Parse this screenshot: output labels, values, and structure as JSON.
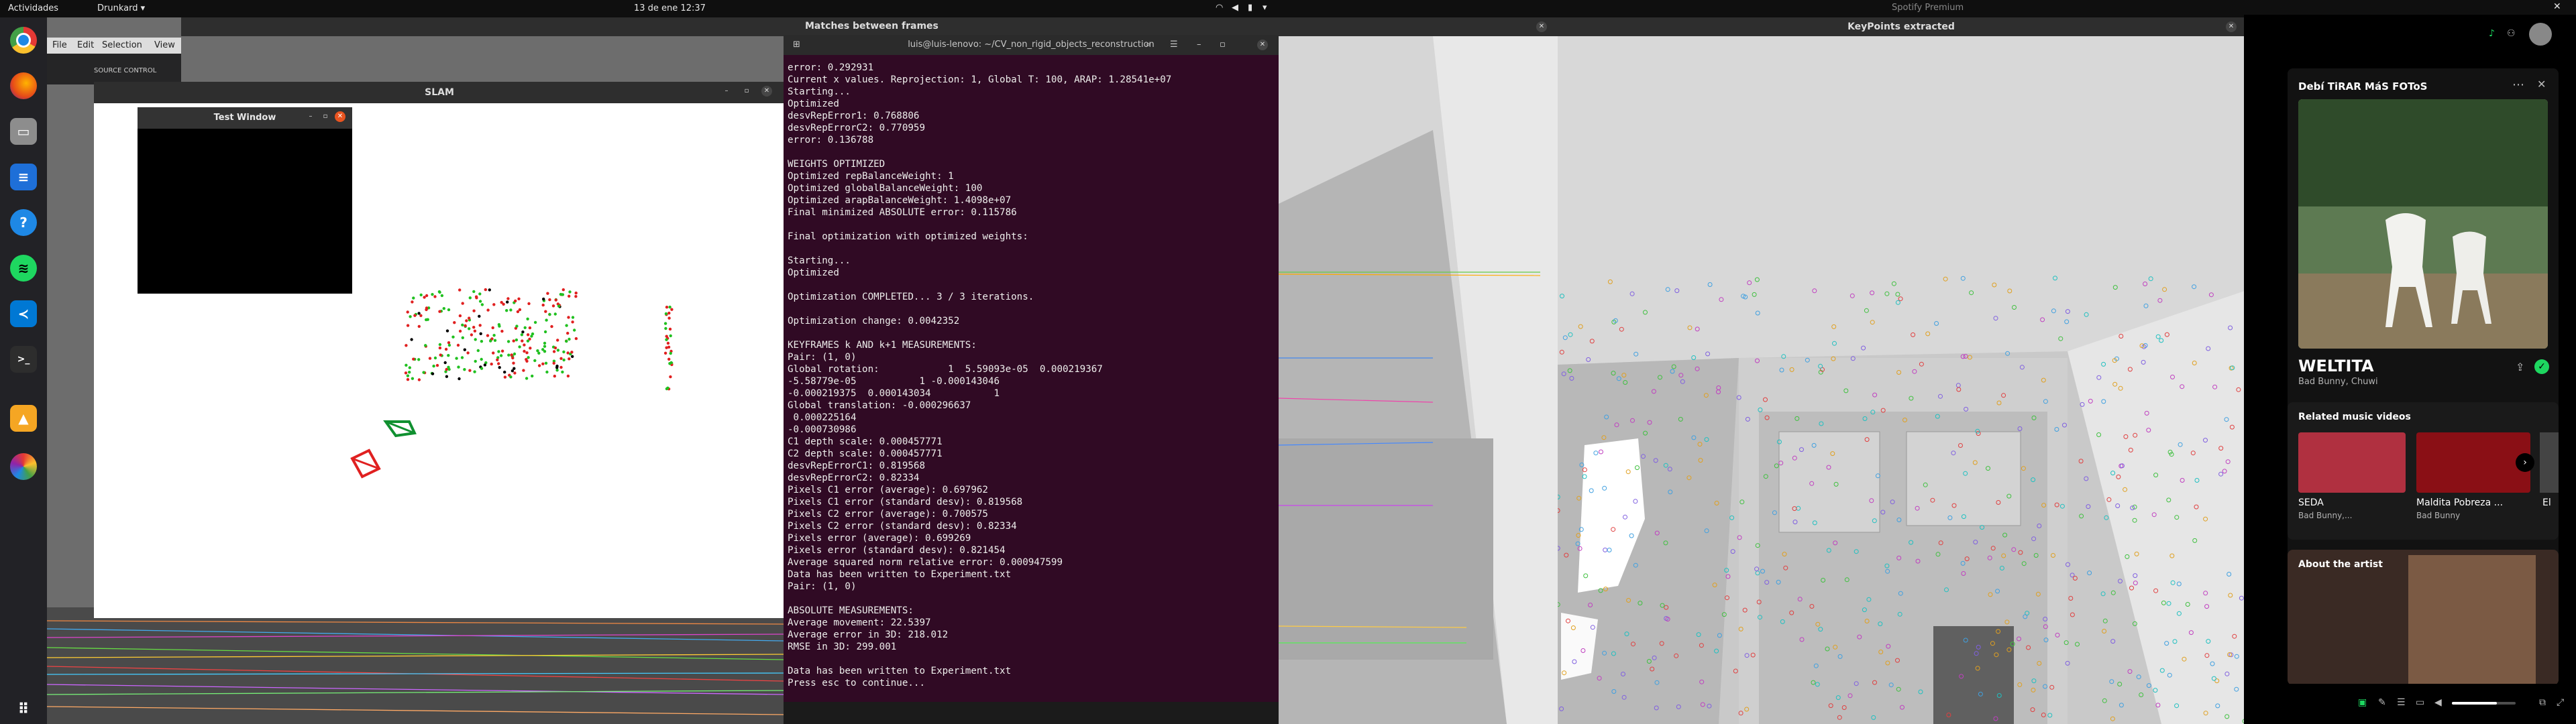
{
  "topbar": {
    "activities": "Actividades",
    "app_menu": "Drunkard",
    "clock": "13 de ene  12:37"
  },
  "dock": {
    "icons": [
      "chrome-icon",
      "firefox-icon",
      "files-icon",
      "writer-icon",
      "help-icon",
      "spotify-icon",
      "vscode-icon",
      "terminal-icon",
      "vlc-icon",
      "color-picker-icon",
      "apps-grid-icon"
    ]
  },
  "vscode": {
    "menu": [
      "File",
      "Edit",
      "Selection",
      "View"
    ],
    "sidebar_label": "SOURCE CONTROL"
  },
  "matches_window": {
    "title": "Matches between frames"
  },
  "keypoints_window": {
    "title": "KeyPoints extracted"
  },
  "spotify": {
    "header_title": "Spotify Premium",
    "playlist_name": "Debí TiRAR MáS FOToS",
    "song_title": "WELTITA",
    "artists": "Bad Bunny, Chuwi",
    "related_heading": "Related music videos",
    "videos": [
      {
        "title": "SEDA",
        "artist": "Bad Bunny,..."
      },
      {
        "title": "Maldita Pobreza ...",
        "artist": "Bad Bunny"
      },
      {
        "title": "El",
        "artist": ""
      }
    ],
    "about_heading": "About the artist"
  },
  "slam_window": {
    "title": "SLAM"
  },
  "test_window": {
    "title": "Test Window"
  },
  "terminal": {
    "title": "luis@luis-lenovo: ~/CV_non_rigid_objects_reconstruction",
    "lines": [
      "error: 0.292931",
      "Current x values. Reprojection: 1, Global T: 100, ARAP: 1.28541e+07",
      "Starting...",
      "Optimized",
      "desvRepError1: 0.768806",
      "desvRepErrorC2: 0.770959",
      "error: 0.136788",
      "",
      "WEIGHTS OPTIMIZED",
      "Optimized repBalanceWeight: 1",
      "Optimized globalBalanceWeight: 100",
      "Optimized arapBalanceWeight: 1.4098e+07",
      "Final minimized ABSOLUTE error: 0.115786",
      "",
      "Final optimization with optimized weights:",
      "",
      "Starting...",
      "Optimized",
      "",
      "Optimization COMPLETED... 3 / 3 iterations.",
      "",
      "Optimization change: 0.0042352",
      "",
      "KEYFRAMES k AND k+1 MEASUREMENTS:",
      "Pair: (1, 0)",
      "Global rotation:            1  5.59093e-05  0.000219367",
      "-5.58779e-05           1 -0.000143046",
      "-0.000219375  0.000143034           1",
      "Global translation: -0.000296637",
      " 0.000225164",
      "-0.000730986",
      "C1 depth scale: 0.000457771",
      "C2 depth scale: 0.000457771",
      "desvRepErrorC1: 0.819568",
      "desvRepErrorC2: 0.82334",
      "Pixels C1 error (average): 0.697962",
      "Pixels C1 error (standard desv): 0.819568",
      "Pixels C2 error (average): 0.700575",
      "Pixels C2 error (standard desv): 0.82334",
      "Pixels error (average): 0.699269",
      "Pixels error (standard desv): 0.821454",
      "Average squared norm relative error: 0.000947599",
      "Data has been written to Experiment.txt",
      "Pair: (1, 0)",
      "",
      "ABSOLUTE MEASUREMENTS:",
      "Average movement: 22.5397",
      "Average error in 3D: 218.012",
      "RMSE in 3D: 299.001",
      "",
      "Data has been written to Experiment.txt",
      "Press esc to continue..."
    ]
  },
  "colors": {
    "terminal_bg": "#300a24",
    "spotify_accent": "#1ed760",
    "slam_red": "#e02020",
    "slam_green": "#109030"
  }
}
